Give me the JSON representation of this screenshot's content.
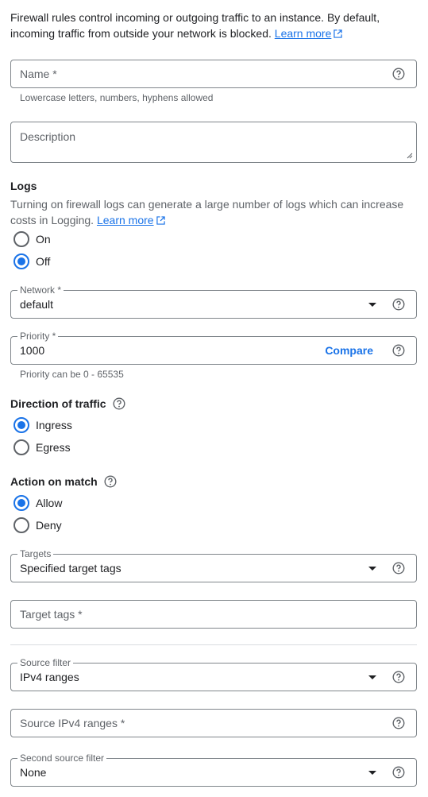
{
  "intro": {
    "text": "Firewall rules control incoming or outgoing traffic to an instance. By default, incoming traffic from outside your network is blocked.",
    "link": "Learn more"
  },
  "name_field": {
    "placeholder": "Name *",
    "hint": "Lowercase letters, numbers, hyphens allowed"
  },
  "description_field": {
    "placeholder": "Description"
  },
  "logs": {
    "title": "Logs",
    "description": "Turning on firewall logs can generate a large number of logs which can increase costs in Logging.",
    "link": "Learn more",
    "options": [
      "On",
      "Off"
    ],
    "selected": "Off"
  },
  "network": {
    "label": "Network *",
    "value": "default"
  },
  "priority": {
    "label": "Priority *",
    "value": "1000",
    "compare": "Compare",
    "hint": "Priority can be 0 - 65535"
  },
  "direction": {
    "title": "Direction of traffic",
    "options": [
      "Ingress",
      "Egress"
    ],
    "selected": "Ingress"
  },
  "action": {
    "title": "Action on match",
    "options": [
      "Allow",
      "Deny"
    ],
    "selected": "Allow"
  },
  "targets": {
    "label": "Targets",
    "value": "Specified target tags"
  },
  "target_tags": {
    "placeholder": "Target tags *"
  },
  "source_filter": {
    "label": "Source filter",
    "value": "IPv4 ranges"
  },
  "source_ranges": {
    "placeholder": "Source IPv4 ranges *"
  },
  "second_source_filter": {
    "label": "Second source filter",
    "value": "None"
  },
  "colors": {
    "accent": "#1a73e8",
    "border": "#80868b",
    "muted": "#5f6368"
  },
  "icons": [
    "help-icon",
    "external-link-icon",
    "dropdown-caret-icon"
  ]
}
